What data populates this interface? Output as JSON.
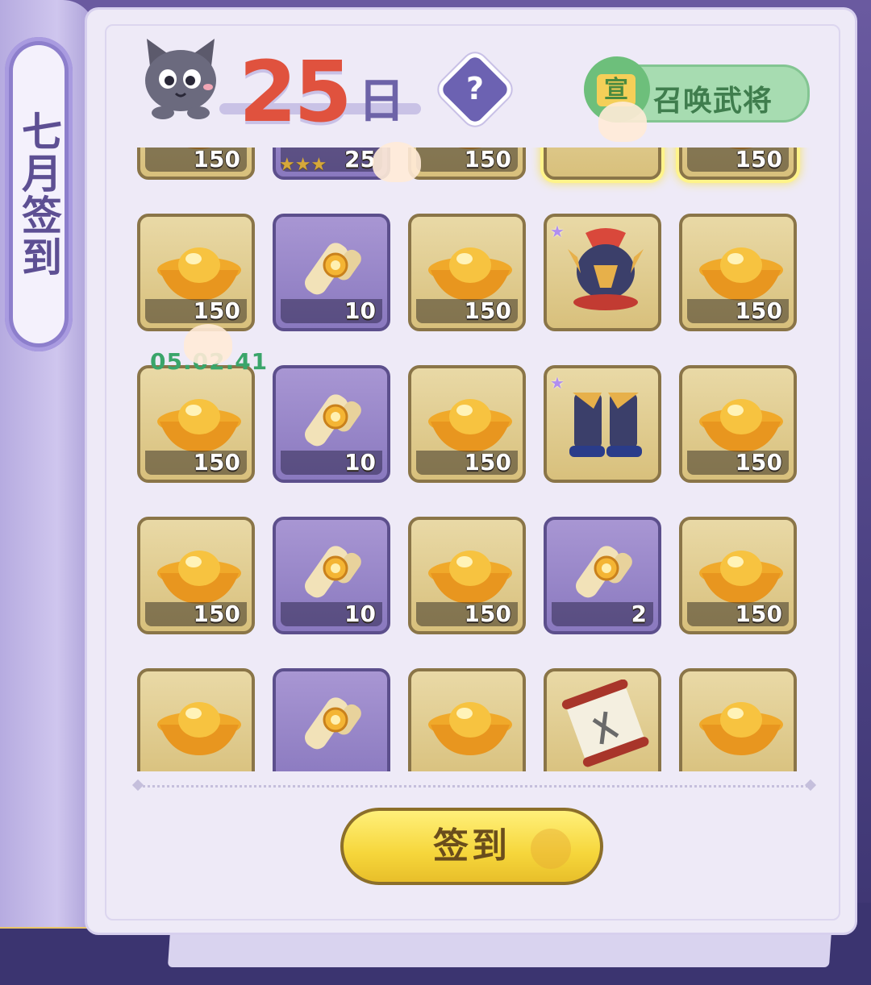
{
  "sidebar": {
    "title": "七月签到"
  },
  "header": {
    "day_number": "25",
    "day_unit": "日",
    "help_label": "?"
  },
  "summon": {
    "icon_label": "宣",
    "label": "召唤武将"
  },
  "timer": "05.02.41",
  "rows": [
    [
      {
        "type": "gold",
        "item": "ingot",
        "qty": "150"
      },
      {
        "type": "purple",
        "item": "hero-card",
        "qty": "25",
        "stars": "★★★"
      },
      {
        "type": "gold",
        "item": "ingot",
        "qty": "150"
      },
      {
        "type": "gold",
        "item": "hero-armor",
        "qty": "",
        "glow": true
      },
      {
        "type": "gold",
        "item": "ingot",
        "qty": "150",
        "glow": true
      }
    ],
    [
      {
        "type": "gold",
        "item": "ingot",
        "qty": "150"
      },
      {
        "type": "purple",
        "item": "scroll",
        "qty": "10"
      },
      {
        "type": "gold",
        "item": "ingot",
        "qty": "150"
      },
      {
        "type": "gold",
        "item": "hero-helmet",
        "qty": "",
        "star": "★"
      },
      {
        "type": "gold",
        "item": "ingot",
        "qty": "150"
      }
    ],
    [
      {
        "type": "gold",
        "item": "ingot",
        "qty": "150"
      },
      {
        "type": "purple",
        "item": "scroll",
        "qty": "10"
      },
      {
        "type": "gold",
        "item": "ingot",
        "qty": "150"
      },
      {
        "type": "gold",
        "item": "hero-boots",
        "qty": "",
        "star": "★"
      },
      {
        "type": "gold",
        "item": "ingot",
        "qty": "150"
      }
    ],
    [
      {
        "type": "gold",
        "item": "ingot",
        "qty": "150"
      },
      {
        "type": "purple",
        "item": "scroll",
        "qty": "10"
      },
      {
        "type": "gold",
        "item": "ingot",
        "qty": "150"
      },
      {
        "type": "purple",
        "item": "scroll",
        "qty": "2"
      },
      {
        "type": "gold",
        "item": "ingot",
        "qty": "150"
      }
    ],
    [
      {
        "type": "gold",
        "item": "ingot",
        "qty": ""
      },
      {
        "type": "purple",
        "item": "scroll",
        "qty": ""
      },
      {
        "type": "gold",
        "item": "ingot",
        "qty": ""
      },
      {
        "type": "gold",
        "item": "decree-scroll",
        "qty": ""
      },
      {
        "type": "gold",
        "item": "ingot",
        "qty": ""
      }
    ]
  ],
  "checkin_button": {
    "label": "签到"
  },
  "colors": {
    "accent_red": "#e0523e",
    "gold_button": "#f6d63b",
    "summon_green": "#a7dcb1",
    "timer_green": "#3aa56a"
  }
}
